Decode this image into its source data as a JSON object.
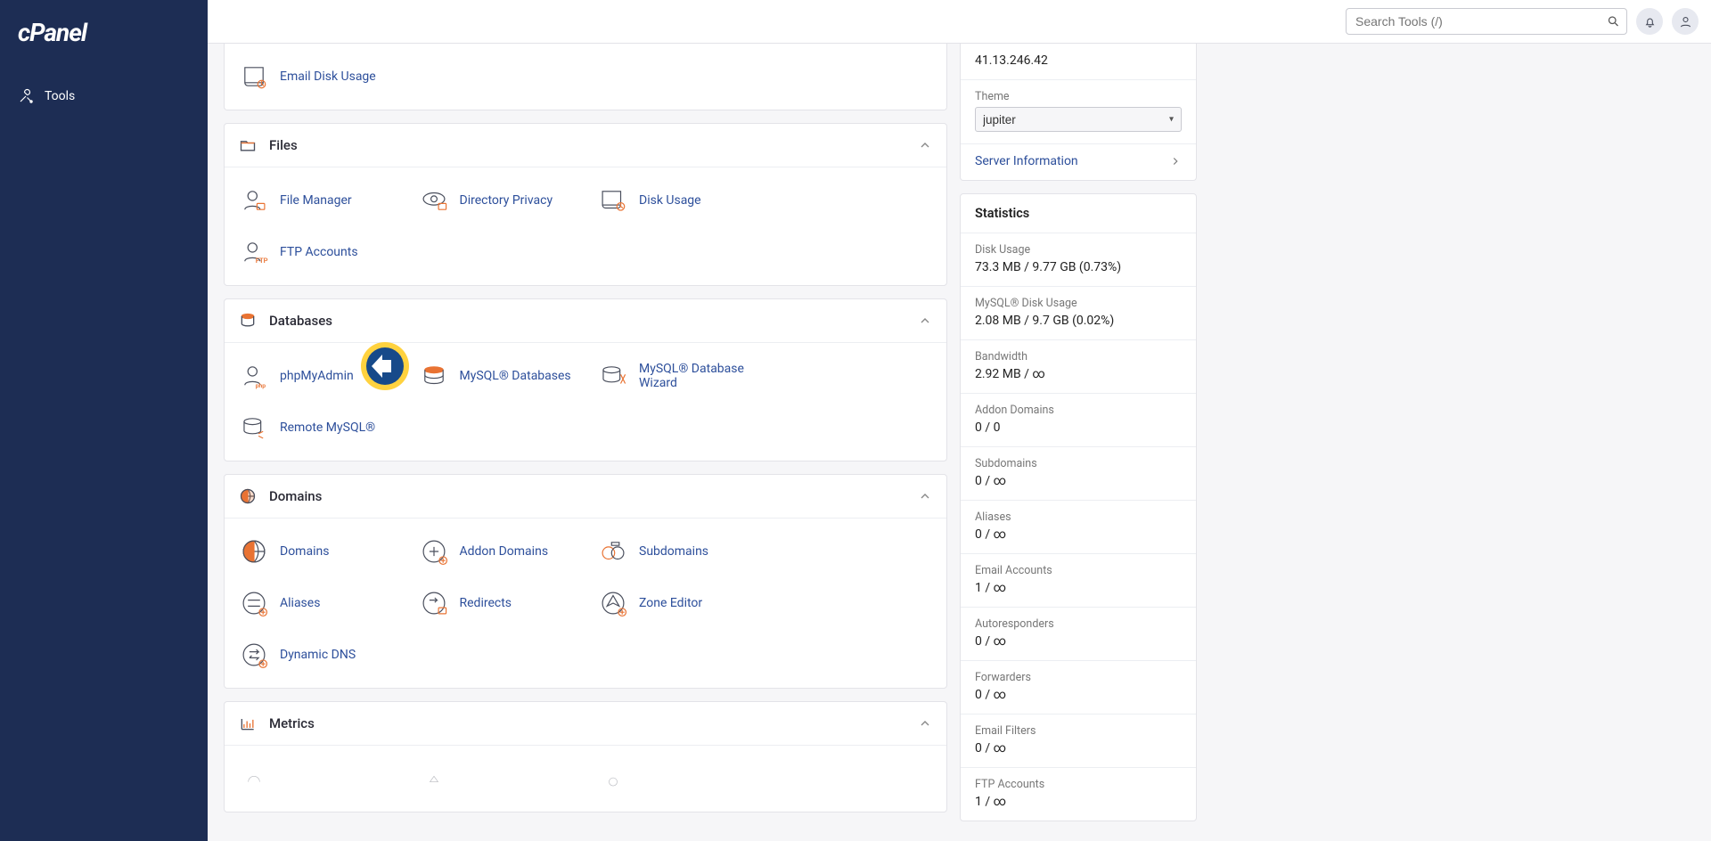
{
  "brand": "cPanel",
  "nav": {
    "tools": "Tools"
  },
  "topbar": {
    "search_placeholder": "Search Tools (/)"
  },
  "groups": {
    "email": {
      "items": [
        {
          "label": "Email Disk Usage"
        }
      ]
    },
    "files": {
      "label": "Files",
      "items": [
        {
          "label": "File Manager"
        },
        {
          "label": "Directory Privacy"
        },
        {
          "label": "Disk Usage"
        },
        {
          "label": "FTP Accounts"
        }
      ]
    },
    "databases": {
      "label": "Databases",
      "items": [
        {
          "label": "phpMyAdmin"
        },
        {
          "label": "MySQL® Databases"
        },
        {
          "label": "MySQL® Database Wizard"
        },
        {
          "label": "Remote MySQL®"
        }
      ]
    },
    "domains": {
      "label": "Domains",
      "items": [
        {
          "label": "Domains"
        },
        {
          "label": "Addon Domains"
        },
        {
          "label": "Subdomains"
        },
        {
          "label": "Aliases"
        },
        {
          "label": "Redirects"
        },
        {
          "label": "Zone Editor"
        },
        {
          "label": "Dynamic DNS"
        }
      ]
    },
    "metrics": {
      "label": "Metrics"
    }
  },
  "general": {
    "ip_value": "41.13.246.42",
    "theme_label": "Theme",
    "theme_value": "jupiter",
    "server_info": "Server Information"
  },
  "stats": {
    "title": "Statistics",
    "rows": [
      {
        "label": "Disk Usage",
        "value": "73.3 MB / 9.77 GB   (0.73%)"
      },
      {
        "label": "MySQL® Disk Usage",
        "value": "2.08 MB / 9.7 GB   (0.02%)"
      },
      {
        "label": "Bandwidth",
        "value": "2.92 MB / ∞"
      },
      {
        "label": "Addon Domains",
        "value": "0 / 0"
      },
      {
        "label": "Subdomains",
        "value": "0 / ∞"
      },
      {
        "label": "Aliases",
        "value": "0 / ∞"
      },
      {
        "label": "Email Accounts",
        "value": "1 / ∞"
      },
      {
        "label": "Autoresponders",
        "value": "0 / ∞"
      },
      {
        "label": "Forwarders",
        "value": "0 / ∞"
      },
      {
        "label": "Email Filters",
        "value": "0 / ∞"
      },
      {
        "label": "FTP Accounts",
        "value": "1 / ∞"
      }
    ]
  },
  "marker": {
    "description": "Left-pointing arrow annotation pointing at phpMyAdmin item"
  }
}
